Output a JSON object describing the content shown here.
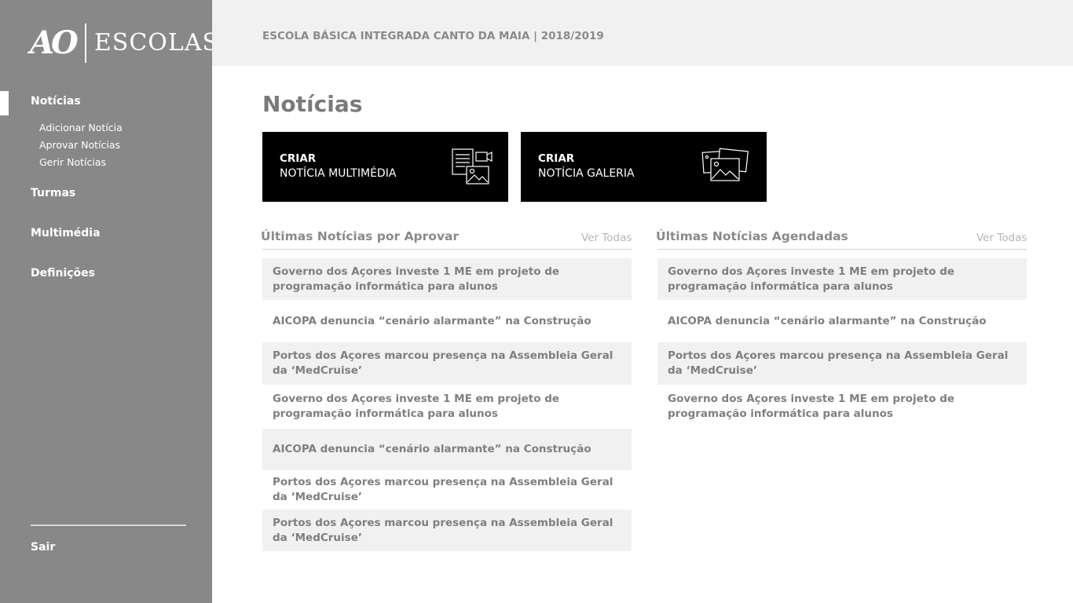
{
  "brand": {
    "mark": "AO",
    "name": "ESCOLAS"
  },
  "sidebar": {
    "items": [
      {
        "label": "Notícias"
      },
      {
        "label": "Turmas"
      },
      {
        "label": "Multimédia"
      },
      {
        "label": "Definições"
      }
    ],
    "sub_items": [
      {
        "label": "Adicionar Notícia"
      },
      {
        "label": "Aprovar Notícias"
      },
      {
        "label": "Gerir Notícias"
      }
    ],
    "logout": "Sair"
  },
  "header": {
    "school": "ESCOLA BÁSICA INTEGRADA CANTO DA MAIA  | 2018/2019"
  },
  "page": {
    "title": "Notícias"
  },
  "create_cards": [
    {
      "line1": "CRIAR",
      "line2": "NOTÍCIA MULTIMÉDIA",
      "icon": "document-video-icon"
    },
    {
      "line1": "CRIAR",
      "line2": "NOTÍCIA GALERIA",
      "icon": "photo-gallery-icon"
    }
  ],
  "pending_list": {
    "title": "Últimas Notícias por Aprovar",
    "see_all": "Ver Todas",
    "items": [
      "Governo dos Açores investe 1 ME em projeto de programação informática para alunos",
      "AICOPA denuncia “cenário alarmante” na Construção",
      "Portos dos Açores marcou presença na Assembleia Geral da ‘MedCruise’",
      "Governo dos Açores investe 1 ME em projeto de programação informática para alunos",
      "AICOPA denuncia “cenário alarmante” na Construção",
      "Portos dos Açores marcou presença na Assembleia Geral da ‘MedCruise’",
      "Portos dos Açores marcou presença na Assembleia Geral da ‘MedCruise’"
    ]
  },
  "scheduled_list": {
    "title": "Últimas Notícias Agendadas",
    "see_all": "Ver Todas",
    "items": [
      "Governo dos Açores investe 1 ME em projeto de programação informática para alunos",
      "AICOPA denuncia “cenário alarmante” na Construção",
      "Portos dos Açores marcou presença na Assembleia Geral da ‘MedCruise’",
      "Governo dos Açores investe 1 ME em projeto de programação informática para alunos"
    ]
  },
  "colors": {
    "sidebar_bg": "#888888",
    "header_bg": "#f1f1f1",
    "card_bg": "#000000",
    "row_shade": "#f1f1f1",
    "text_muted": "#7f7f7f"
  }
}
